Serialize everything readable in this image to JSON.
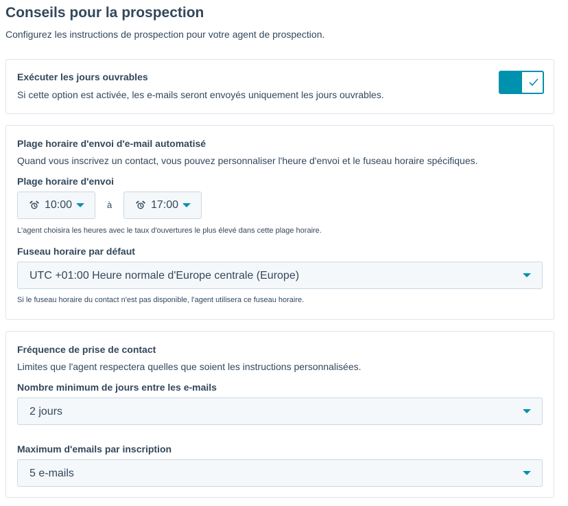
{
  "page": {
    "title": "Conseils pour la prospection",
    "subtitle": "Configurez les instructions de prospection pour votre agent de prospection."
  },
  "business_days": {
    "title": "Exécuter les jours ouvrables",
    "description": "Si cette option est activée, les e-mails seront envoyés uniquement les jours ouvrables.",
    "toggle_on": true,
    "toggle_icon": "check-icon"
  },
  "send_window": {
    "title": "Plage horaire d'envoi d'e-mail automatisé",
    "description": "Quand vous inscrivez un contact, vous pouvez personnaliser l'heure d'envoi et le fuseau horaire spécifiques.",
    "range_label": "Plage horaire d'envoi",
    "start_time": "10:00",
    "between": "à",
    "end_time": "17:00",
    "time_icon": "alarm-clock-icon",
    "range_help": "L'agent choisira les heures avec le taux d'ouvertures le plus élevé dans cette plage horaire.",
    "timezone_label": "Fuseau horaire par défaut",
    "timezone_value": "UTC +01:00 Heure normale d'Europe centrale (Europe)",
    "timezone_help": "Si le fuseau horaire du contact n'est pas disponible, l'agent utilisera ce fuseau horaire."
  },
  "frequency": {
    "title": "Fréquence de prise de contact",
    "description": "Limites que l'agent respectera quelles que soient les instructions personnalisées.",
    "min_days_label": "Nombre minimum de jours entre les e-mails",
    "min_days_value": "2 jours",
    "max_emails_label": "Maximum d'emails par inscription",
    "max_emails_value": "5 e-mails"
  },
  "colors": {
    "accent": "#0091ae",
    "text": "#33475b",
    "border": "#dfe3eb",
    "input_bg": "#f5f8fa"
  }
}
